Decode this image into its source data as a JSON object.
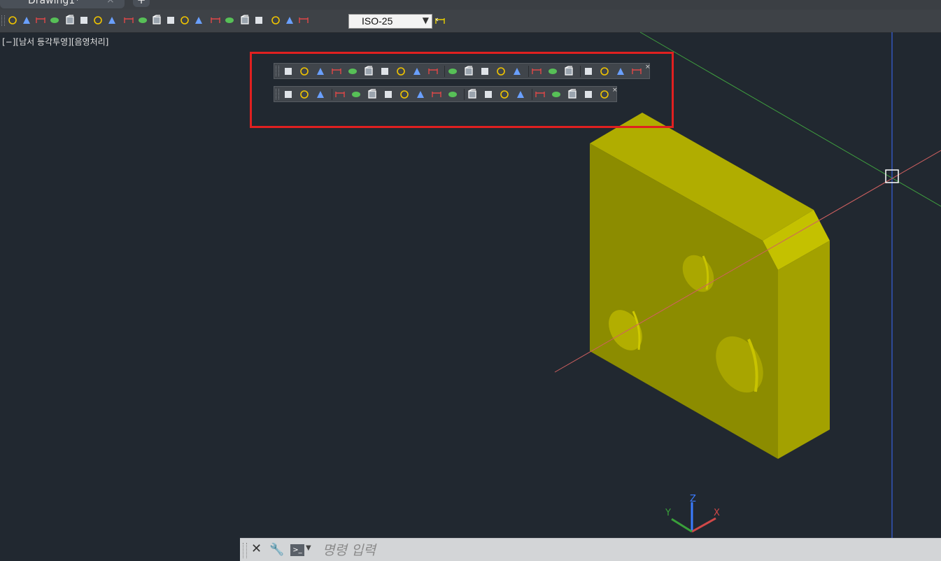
{
  "window": {
    "tab_title": "Drawing1*",
    "tab_close": "×",
    "new_tab": "+"
  },
  "dimension_toolbar": {
    "dim_style_value": "ISO-25",
    "icons": [
      "linear-dim-icon",
      "aligned-dim-icon",
      "arc-length-icon",
      "ordinate-dim-icon",
      "radius-dim-icon",
      "jogged-icon",
      "diameter-dim-icon",
      "angular-dim-icon",
      "quick-dim-icon",
      "baseline-dim-icon",
      "continue-dim-icon",
      "dim-space-icon",
      "dim-break-icon",
      "tolerance-icon",
      "center-mark-icon",
      "inspection-icon",
      "jogged-linear-icon",
      "dim-edit-icon",
      "dim-text-edit-icon",
      "dim-update-icon",
      "dim-style-icon"
    ]
  },
  "viewport": {
    "label": "[−][남서 등각투영][음영처리]"
  },
  "modeling_toolbar": {
    "icons": [
      "polysolid-icon",
      "box-icon",
      "wedge-icon",
      "cone-icon",
      "sphere-icon",
      "cylinder-icon",
      "torus-icon",
      "pyramid-icon",
      "helix-icon",
      "planar-surface-icon",
      "extrude-icon",
      "presspull-icon",
      "sweep-icon",
      "revolve-icon",
      "loft-icon",
      "union-icon",
      "subtract-icon",
      "intersect-icon",
      "3d-move-icon",
      "3d-rotate-icon",
      "3d-align-icon",
      "3d-array-icon"
    ],
    "close": "×"
  },
  "solid_editing_toolbar": {
    "icons": [
      "union-icon",
      "subtract-icon",
      "intersect-icon",
      "extrude-faces-icon",
      "move-faces-icon",
      "offset-faces-icon",
      "delete-faces-icon",
      "rotate-faces-icon",
      "taper-faces-icon",
      "copy-faces-icon",
      "color-faces-icon",
      "copy-edges-icon",
      "color-edges-icon",
      "imprint-icon",
      "clean-icon",
      "separate-icon",
      "shell-icon",
      "check-icon",
      "slice-icon",
      "solid-edit-icon"
    ],
    "close": "×"
  },
  "ucs_icon": {
    "x_label": "X",
    "y_label": "Y",
    "z_label": "Z"
  },
  "command_line": {
    "close": "✕",
    "placeholder": "명령 입력"
  },
  "colors": {
    "background": "#212830",
    "solid_front": "#8c8c00",
    "solid_top": "#b0ad00",
    "solid_side": "#a3a100",
    "highlight": "#e02020",
    "axis_x": "#d06060",
    "axis_y": "#40a040",
    "crosshair": "#3a6cff"
  }
}
